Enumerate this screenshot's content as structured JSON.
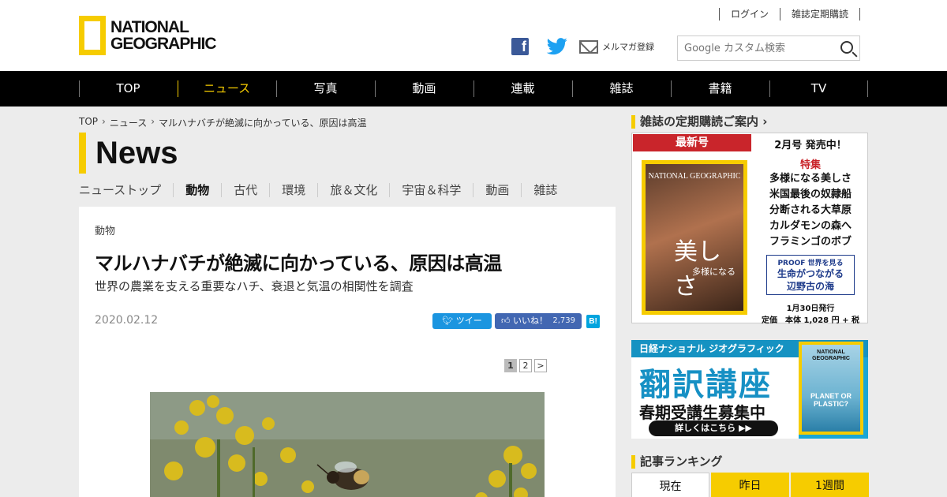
{
  "header": {
    "logo_line1": "NATIONAL",
    "logo_line2": "GEOGRAPHIC",
    "login": "ログイン",
    "subscribe": "雑誌定期購読",
    "facebook_icon": "f",
    "newsletter": "メルマガ登録",
    "search_placeholder": "Google カスタム検索"
  },
  "nav": {
    "items": [
      "TOP",
      "ニュース",
      "写真",
      "動画",
      "連載",
      "雑誌",
      "書籍",
      "TV"
    ],
    "active_index": 1,
    "accent_color": "#f6cc00"
  },
  "breadcrumb": [
    "TOP",
    "ニュース",
    "マルハナバチが絶滅に向かっている、原因は高温"
  ],
  "section_title": "News",
  "subnav": [
    "ニューストップ",
    "動物",
    "古代",
    "環境",
    "旅＆文化",
    "宇宙＆科学",
    "動画",
    "雑誌"
  ],
  "article": {
    "category": "動物",
    "headline": "マルハナバチが絶滅に向かっている、原因は高温",
    "subheadline": "世界の農業を支える重要なハチ、衰退と気温の相関性を調査",
    "date": "2020.02.12",
    "tweet_label": "ツイート",
    "like_label": "いいね！",
    "like_count": "2,739",
    "hatena_label": "B!",
    "pages": [
      "1",
      "2",
      ">"
    ]
  },
  "sidebar": {
    "subscription_heading": "雑誌の定期購読ご案内",
    "magazine": {
      "banner": "最新号",
      "issue": "2月号 発売中！",
      "feature_label": "特集",
      "features": [
        "多様になる美しさ",
        "米国最後の奴隷船",
        "分断される大草原",
        "カルダモンの森へ",
        "フラミンゴのボブ"
      ],
      "proof_title": "PROOF 世界を見る",
      "proof_body1": "生命がつながる",
      "proof_body2": "辺野古の海",
      "release": "1月30日発行",
      "price": "定価　本体 1,028 円 + 税",
      "cover_ng": "NATIONAL GEOGRAPHIC",
      "cover_title_small": "多様になる",
      "cover_title_big": "美しさ"
    },
    "ad": {
      "top": "日経ナショナル ジオグラフィック",
      "title": "翻訳講座",
      "sub": "春期受講生募集中",
      "button": "詳しくはこちら ▶▶",
      "cover_ng": "NATIONAL GEOGRAPHIC",
      "cover_title": "PLANET OR PLASTIC?"
    },
    "ranking_heading": "記事ランキング",
    "ranking_tabs": [
      "現在",
      "昨日",
      "1週間"
    ]
  }
}
